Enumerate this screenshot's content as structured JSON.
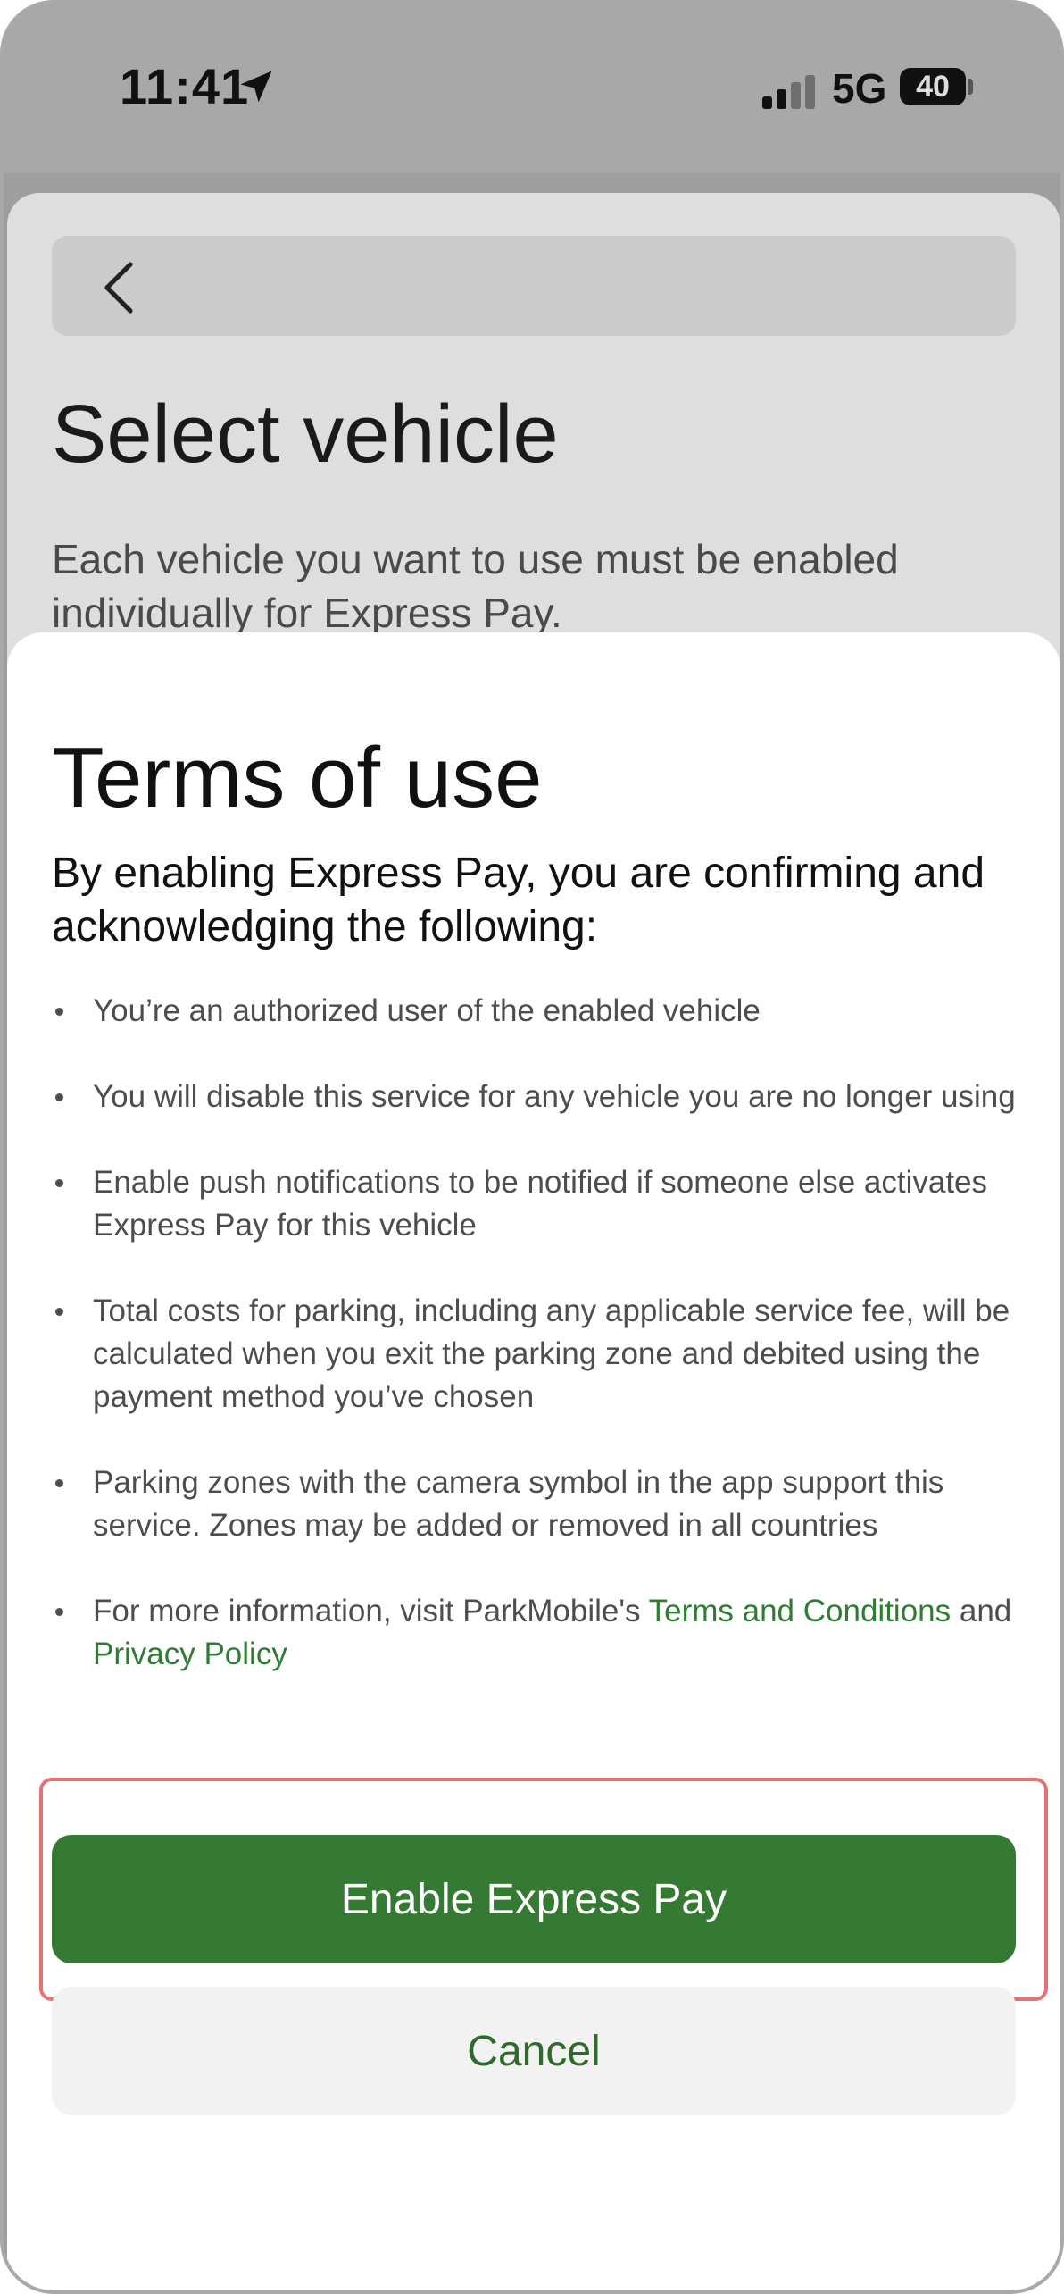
{
  "status_bar": {
    "time": "11:41",
    "network": "5G",
    "battery": "40"
  },
  "background_screen": {
    "title": "Select vehicle",
    "description": "Each vehicle you want to use must be enabled individually for Express Pay."
  },
  "terms_sheet": {
    "title": "Terms of use",
    "intro": "By enabling Express Pay, you are confirming and acknowledging the following:",
    "bullets": [
      "You’re an authorized user of the enabled vehicle",
      "You will disable this service for any vehicle you are no longer using",
      "Enable push notifications to be notified if someone else activates Express Pay for this vehicle",
      "Total costs for parking, including any applicable service fee, will be calculated when you exit the parking zone and debited using the payment method you’ve chosen",
      "Parking zones with the camera symbol in the app support this service. Zones may be added or removed in all countries"
    ],
    "more_info": {
      "prefix": "For more information, visit ParkMobile's ",
      "terms_link": "Terms and Conditions",
      "joiner": " and ",
      "privacy_link": "Privacy Policy"
    },
    "enable_label": "Enable Express Pay",
    "cancel_label": "Cancel"
  },
  "colors": {
    "accent": "#357a32",
    "link": "#2e7d32",
    "highlight": "#e57373"
  }
}
